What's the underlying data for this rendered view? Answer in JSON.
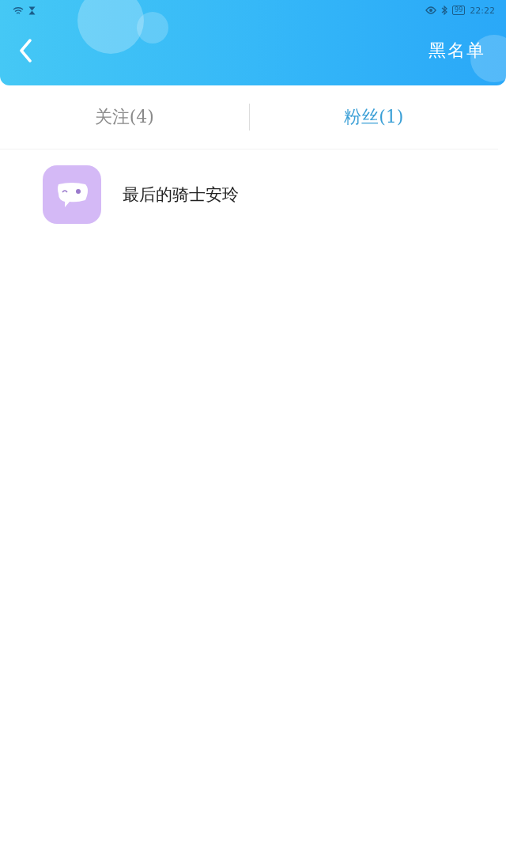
{
  "status_bar": {
    "battery": "99",
    "time": "22:22"
  },
  "header": {
    "title": "黑名单"
  },
  "tabs": [
    {
      "label": "关注(4)",
      "selected": false
    },
    {
      "label": "粉丝(1)",
      "selected": true
    }
  ],
  "users": [
    {
      "name": "最后的骑士安玲"
    }
  ]
}
